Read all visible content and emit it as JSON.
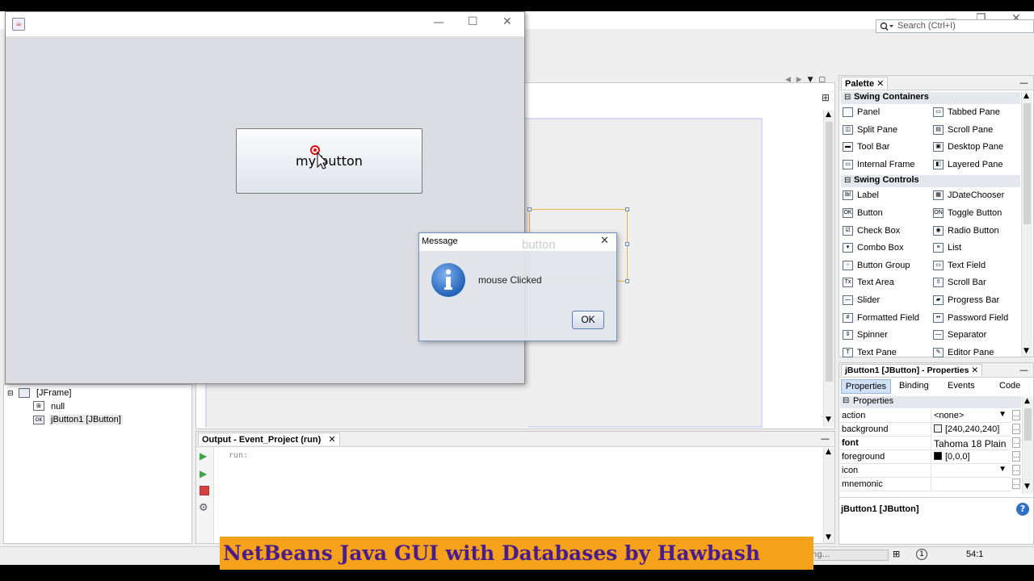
{
  "ide": {
    "search_placeholder": "Search (Ctrl+I)",
    "toolbar_add_icon": "add-icon"
  },
  "palette": {
    "title": "Palette",
    "categories": [
      {
        "label": "Swing Containers",
        "items": [
          "Panel",
          "Tabbed Pane",
          "Split Pane",
          "Scroll Pane",
          "Tool Bar",
          "Desktop Pane",
          "Internal Frame",
          "Layered Pane"
        ]
      },
      {
        "label": "Swing Controls",
        "items": [
          "Label",
          "JDateChooser",
          "Button",
          "Toggle Button",
          "Check Box",
          "Radio Button",
          "Combo Box",
          "List",
          "Button Group",
          "Text Field",
          "Text Area",
          "Scroll Bar",
          "Slider",
          "Progress Bar",
          "Formatted Field",
          "Password Field",
          "Spinner",
          "Separator",
          "Text Pane",
          "Editor Pane"
        ]
      }
    ]
  },
  "properties": {
    "title": "jButton1 [JButton] - Properties",
    "tabs": [
      "Properties",
      "Binding",
      "Events",
      "Code"
    ],
    "section": "Properties",
    "rows": [
      {
        "key": "action",
        "value": "<none>"
      },
      {
        "key": "background",
        "value": "[240,240,240]",
        "swatch": "#f0f0f0"
      },
      {
        "key": "font",
        "value": "Tahoma 18 Plain"
      },
      {
        "key": "foreground",
        "value": "[0,0,0]",
        "swatch": "#000000"
      },
      {
        "key": "icon",
        "value": ""
      },
      {
        "key": "mnemonic",
        "value": ""
      }
    ],
    "footer": "jButton1 [JButton]"
  },
  "navigator": {
    "items": [
      "[JFrame]",
      "null",
      "jButton1 [JButton]"
    ]
  },
  "output": {
    "title": "Output - Event_Project (run)",
    "text": "run:"
  },
  "designer": {
    "ghost_button": "button"
  },
  "running_frame": {
    "button_label": "my button"
  },
  "dialog": {
    "title": "Message",
    "message": "mouse Clicked",
    "ok_label": "OK"
  },
  "status": {
    "position": "54:1",
    "progress_text": "ng..."
  },
  "banner": {
    "text": "NetBeans Java GUI with Databases by Hawbash"
  },
  "colors": {
    "banner_bg": "#f5a21a",
    "banner_text": "#4b1d8c",
    "info_icon": "#2f6fc6",
    "selection": "#cfe0f7"
  }
}
